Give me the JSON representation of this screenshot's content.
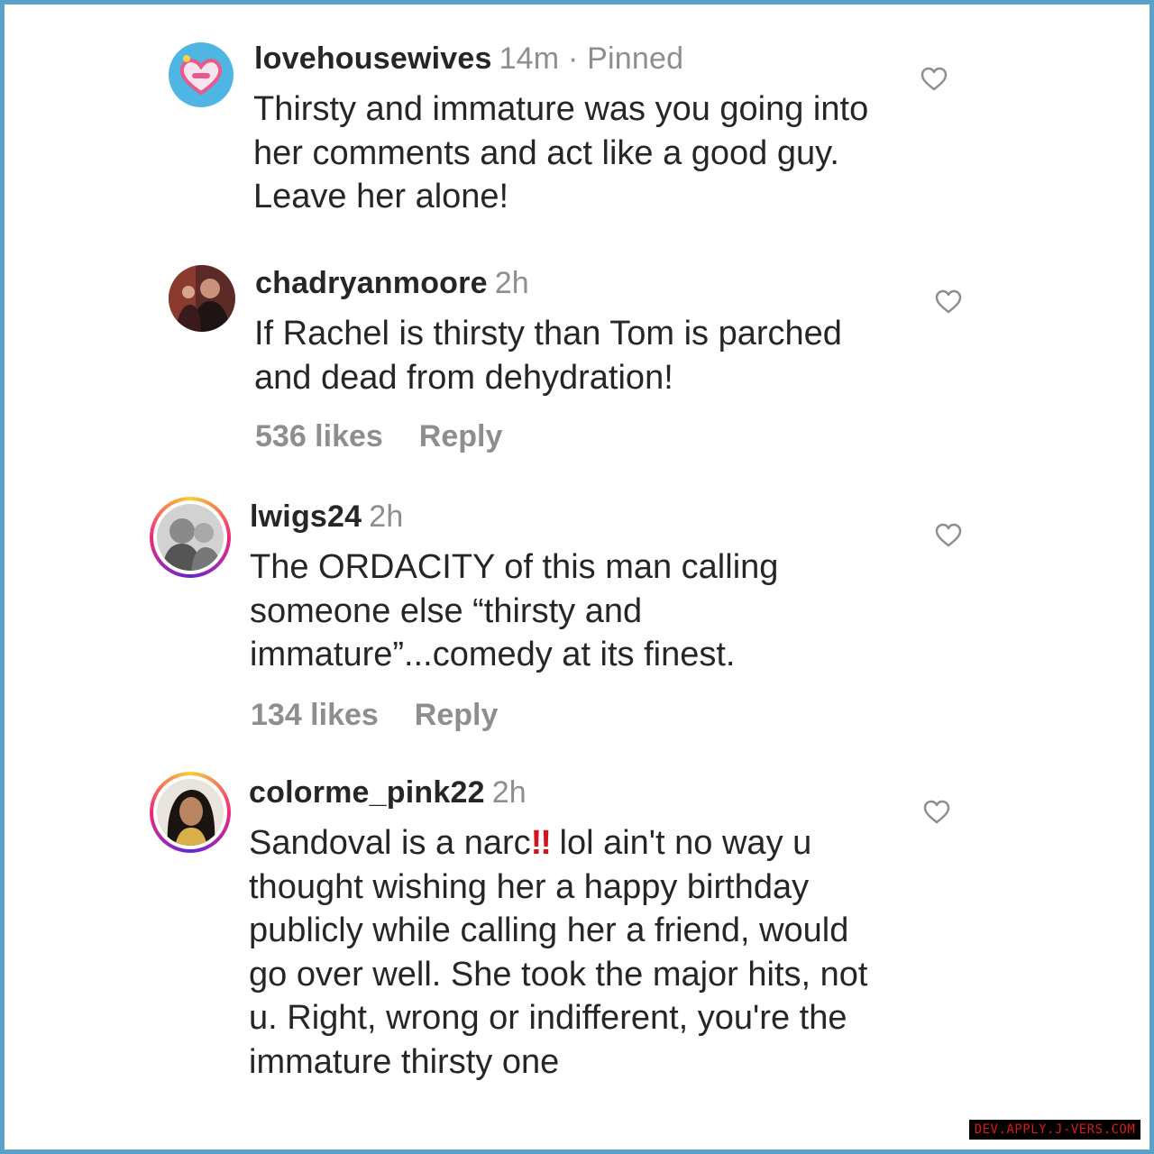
{
  "comments": [
    {
      "username": "lovehousewives",
      "time": "14m",
      "pinned": "· Pinned",
      "text": "Thirsty and immature was you going into her comments and act like a good guy. Leave her alone!",
      "likes": "",
      "reply": ""
    },
    {
      "username": "chadryanmoore",
      "time": "2h",
      "pinned": "",
      "text": "If Rachel is thirsty than Tom is parched and dead from dehydration!",
      "likes": "536 likes",
      "reply": "Reply"
    },
    {
      "username": "lwigs24",
      "time": "2h",
      "pinned": "",
      "text": "The ORDACITY of this man calling someone else “thirsty and immature”...comedy at its finest.",
      "likes": "134 likes",
      "reply": "Reply"
    },
    {
      "username": "colorme_pink22",
      "time": "2h",
      "pinned": "",
      "text_before": "Sandoval is a narc",
      "emoji": "!!",
      "text_after": " lol ain't no way u thought wishing her a happy birthday publicly while calling her a friend, would go over well. She took the major hits, not u. Right, wrong or indifferent, you're the immature thirsty one",
      "likes": "",
      "reply": ""
    }
  ],
  "watermark": "DEV.APPLY.J-VERS.COM",
  "icons": {
    "like": "heart-outline-icon",
    "emoji": "double-exclamation-mark-icon"
  },
  "colors": {
    "frame": "#5aa0c8",
    "text": "#262626",
    "muted": "#8e8e8e",
    "emoji": "#d4141c"
  }
}
